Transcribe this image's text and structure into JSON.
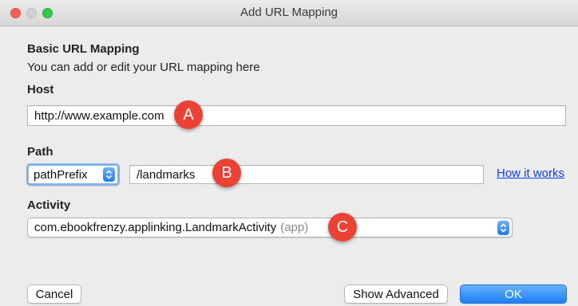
{
  "window": {
    "title": "Add URL Mapping"
  },
  "section": {
    "heading": "Basic URL Mapping",
    "description": "You can add or edit your URL mapping here"
  },
  "host": {
    "label": "Host",
    "value": "http://www.example.com",
    "badge": "A"
  },
  "path": {
    "label": "Path",
    "type_selected": "pathPrefix",
    "value": "/landmarks",
    "badge": "B",
    "help_link": "How it works"
  },
  "activity": {
    "label": "Activity",
    "selected": "com.ebookfrenzy.applinking.LandmarkActivity",
    "module_hint": "(app)",
    "badge": "C"
  },
  "buttons": {
    "cancel": "Cancel",
    "show_advanced": "Show Advanced",
    "ok": "OK"
  },
  "colors": {
    "badge": "#ea4335",
    "accent": "#1c7ff7",
    "link": "#0b3df0"
  }
}
